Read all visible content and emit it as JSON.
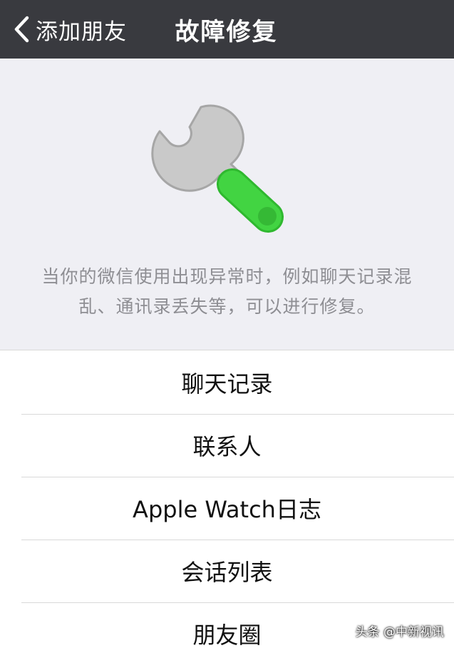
{
  "navbar": {
    "back_label": "添加朋友",
    "title": "故障修复"
  },
  "hero": {
    "icon": "wrench-icon",
    "description_line1": "当你的微信使用出现异常时，例如聊天记录混",
    "description_line2": "乱、通讯录丢失等，可以进行修复。"
  },
  "menu": {
    "items": [
      {
        "label": "聊天记录"
      },
      {
        "label": "联系人"
      },
      {
        "label": "Apple Watch日志"
      },
      {
        "label": "会话列表"
      },
      {
        "label": "朋友圈"
      }
    ]
  },
  "watermark": {
    "text": "头条 @中新视讯"
  },
  "colors": {
    "navbar_bg": "#393a3f",
    "hero_bg": "#efeff4",
    "accent_green": "#3fd13f",
    "wrench_gray": "#c9c9c9"
  }
}
